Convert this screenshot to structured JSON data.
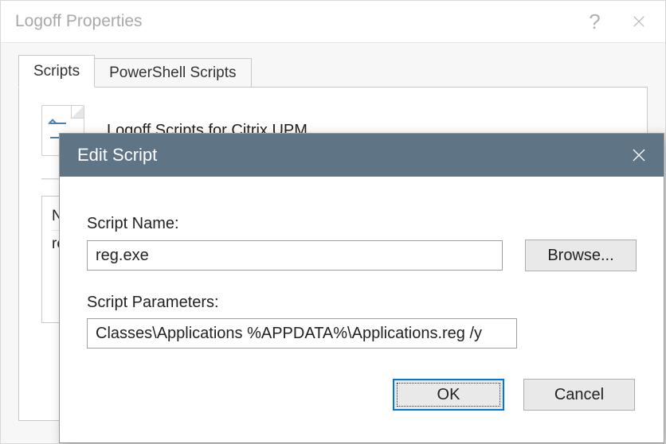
{
  "propWindow": {
    "title": "Logoff Properties",
    "tabs": {
      "scripts": "Scripts",
      "powershell": "PowerShell Scripts"
    },
    "headerText": "Logoff Scripts for Citrix UPM",
    "listHeader": "Na",
    "listFirstRow": "reg"
  },
  "modal": {
    "title": "Edit Script",
    "scriptNameLabel": "Script Name:",
    "scriptNameValue": "reg.exe",
    "browseLabel": "Browse...",
    "scriptParamsLabel": "Script Parameters:",
    "scriptParamsValue": "Classes\\Applications %APPDATA%\\Applications.reg /y",
    "ok": "OK",
    "cancel": "Cancel"
  }
}
